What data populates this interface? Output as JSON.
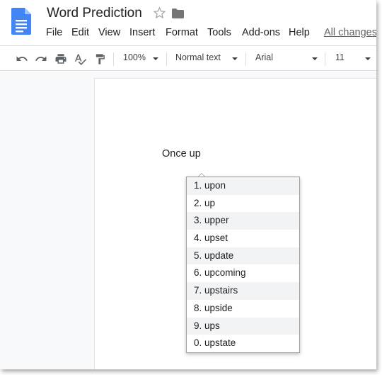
{
  "document": {
    "title": "Word Prediction"
  },
  "menu": {
    "items": [
      "File",
      "Edit",
      "View",
      "Insert",
      "Format",
      "Tools",
      "Add-ons",
      "Help"
    ],
    "save_status": "All changes"
  },
  "toolbar": {
    "zoom": "100%",
    "paragraph_style": "Normal text",
    "font": "Arial",
    "font_size": "11"
  },
  "page": {
    "text": "Once up"
  },
  "suggestions": [
    "1. upon",
    "2. up",
    "3. upper",
    "4. upset",
    "5. update",
    "6. upcoming",
    "7. upstairs",
    "8. upside",
    "9. ups",
    "0. upstate"
  ],
  "icons": {
    "logo": "docs-logo-icon",
    "star": "star-icon",
    "folder": "folder-icon",
    "undo": "undo-icon",
    "redo": "redo-icon",
    "print": "print-icon",
    "spellcheck": "spellcheck-icon",
    "paint_format": "paint-format-icon"
  },
  "colors": {
    "docs_blue": "#4285f4",
    "text": "#202124",
    "muted": "#5f6368"
  }
}
